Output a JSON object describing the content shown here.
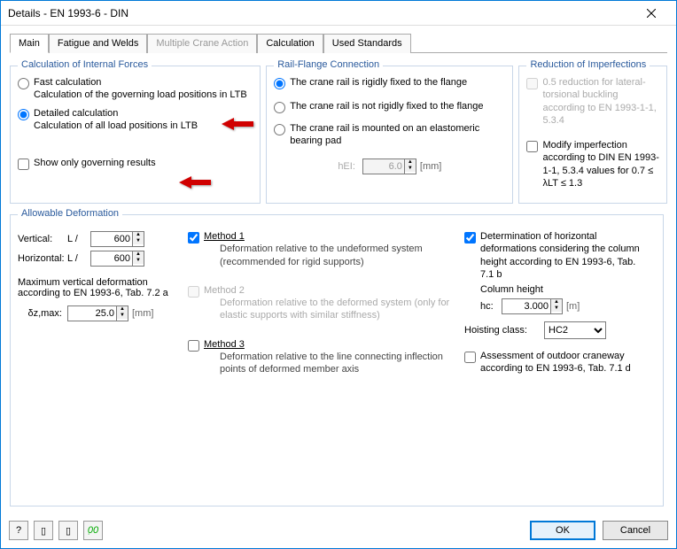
{
  "window": {
    "title": "Details - EN 1993-6 - DIN"
  },
  "tabs": [
    "Main",
    "Fatigue and Welds",
    "Multiple Crane Action",
    "Calculation",
    "Used Standards"
  ],
  "calc_forces": {
    "title": "Calculation of Internal Forces",
    "fast_label": "Fast calculation",
    "fast_sub": "Calculation of the governing load positions in LTB",
    "detailed_label": "Detailed calculation",
    "detailed_sub": "Calculation of all load positions in LTB",
    "show_only": "Show only governing results"
  },
  "rail": {
    "title": "Rail-Flange Connection",
    "opt1": "The crane rail is rigidly fixed to the flange",
    "opt2": "The crane rail is not rigidly fixed to the flange",
    "opt3": "The crane rail is mounted on an elastomeric bearing pad",
    "hEI_label": "hEI:",
    "hEI_value": "6.0",
    "hEI_unit": "[mm]"
  },
  "reduction": {
    "title": "Reduction of Imperfections",
    "r05": "0.5 reduction for lateral-torsional buckling according to EN 1993-1-1, 5.3.4",
    "modify": "Modify imperfection according to DIN EN 1993-1-1, 5.3.4 values for 0.7 ≤ λLT ≤ 1.3"
  },
  "allow": {
    "title": "Allowable Deformation",
    "vertical": "Vertical:",
    "horizontal": "Horizontal:",
    "Lslash": "L /",
    "v_val": "600",
    "h_val": "600",
    "max_vert": "Maximum vertical deformation according to EN 1993-6, Tab. 7.2 a",
    "delta_label": "δz,max:",
    "delta_val": "25.0",
    "mm": "[mm]",
    "m1": "Method 1",
    "m1_sub": "Deformation relative to the undeformed system (recommended for rigid supports)",
    "m2": "Method 2",
    "m2_sub": "Deformation relative to the deformed system (only for elastic supports with similar stiffness)",
    "m3": "Method 3",
    "m3_sub": "Deformation relative to the line connecting inflection points of deformed member axis",
    "det_horiz": "Determination of horizontal deformations considering the column height according to EN 1993-6, Tab. 7.1 b",
    "col_height": "Column height",
    "hc_label": "hc:",
    "hc_val": "3.000",
    "m": "[m]",
    "hoist": "Hoisting class:",
    "hoist_val": "HC2",
    "assess": "Assessment of outdoor craneway according to EN 1993-6, Tab. 7.1 d"
  },
  "footer": {
    "ok": "OK",
    "cancel": "Cancel"
  }
}
